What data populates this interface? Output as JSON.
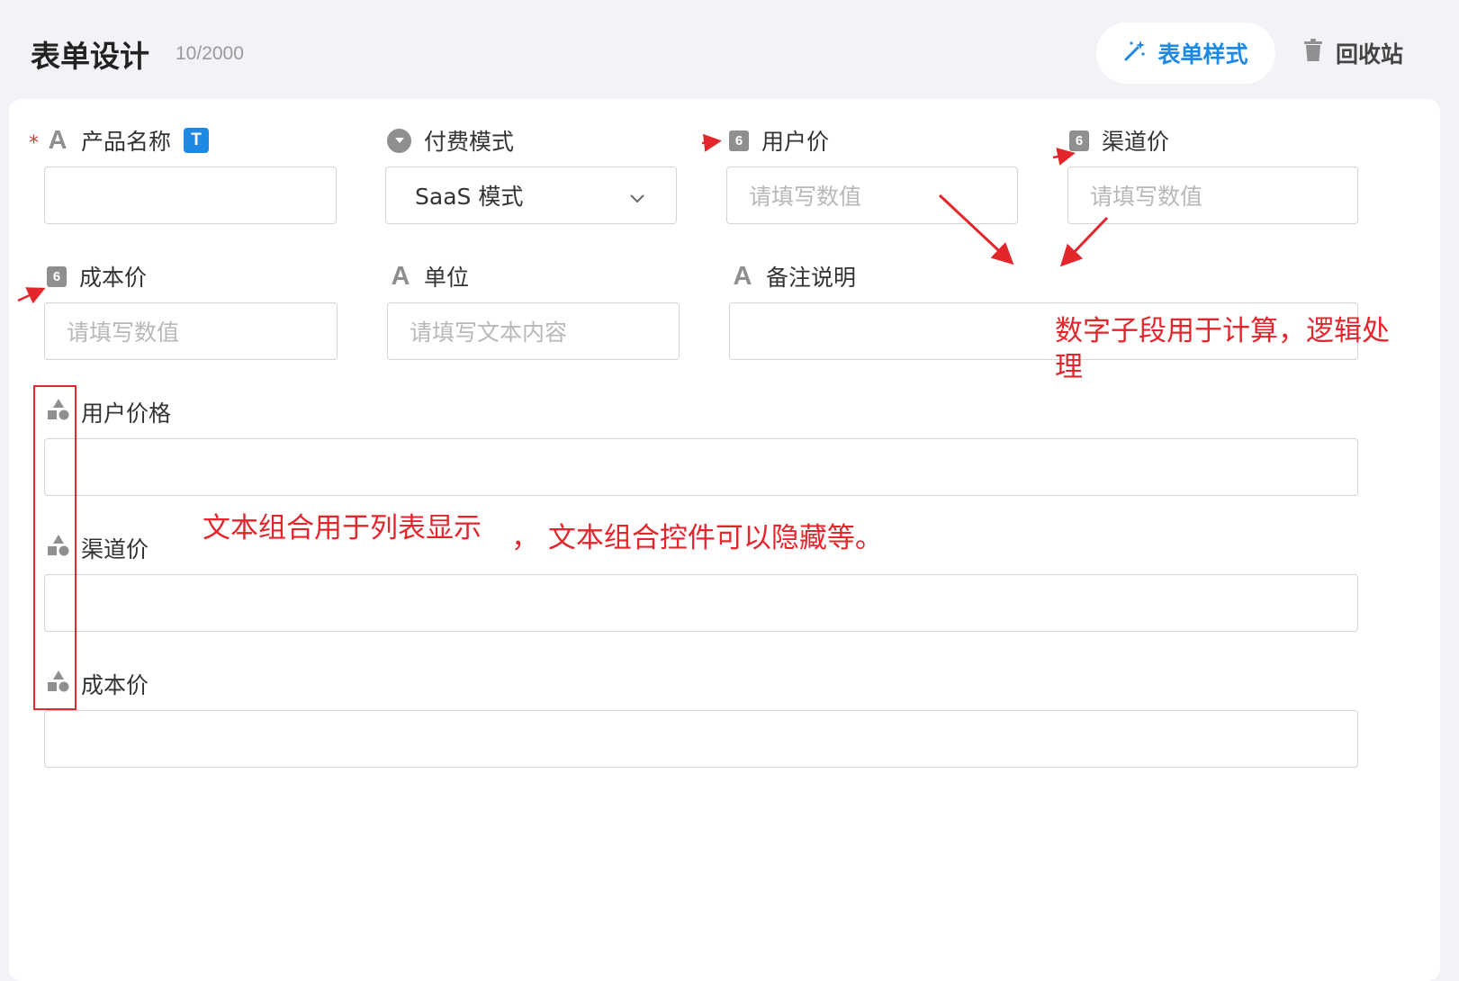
{
  "header": {
    "title": "表单设计",
    "count": "10/2000",
    "style_button": "表单样式",
    "trash_button": "回收站"
  },
  "fields": {
    "product_name": {
      "label": "产品名称",
      "badge": "T",
      "required_mark": "*",
      "value": ""
    },
    "payment_mode": {
      "label": "付费模式",
      "value": "SaaS 模式"
    },
    "user_price": {
      "label": "用户价",
      "icon": "6",
      "placeholder": "请填写数值"
    },
    "channel_price": {
      "label": "渠道价",
      "icon": "6",
      "placeholder": "请填写数值"
    },
    "cost_price": {
      "label": "成本价",
      "icon": "6",
      "placeholder": "请填写数值"
    },
    "unit": {
      "label": "单位",
      "placeholder": "请填写文本内容"
    },
    "remark": {
      "label": "备注说明",
      "value": ""
    },
    "group_user_price": {
      "label": "用户价格",
      "value": ""
    },
    "group_channel_price": {
      "label": "渠道价",
      "value": ""
    },
    "group_cost_price": {
      "label": "成本价",
      "value": ""
    }
  },
  "annotations": {
    "number_note_line1": "数字子段用于计算，逻辑处",
    "number_note_line2": "理",
    "group_note_part1": "文本组合用于列表显示",
    "group_note_part2": "，  文本组合控件可以隐藏等。"
  },
  "icons": {
    "style_button_icon": "magic-wand-icon",
    "trash_button_icon": "trash-icon",
    "text_field_icon": "letter-a-icon",
    "number_field_icon": "number-six-icon",
    "select_field_icon": "dropdown-circle-icon",
    "group_field_icon": "shapes-icon"
  },
  "colors": {
    "accent": "#1e88e5",
    "annotation": "#e3262c",
    "background": "#f3f3f7"
  }
}
